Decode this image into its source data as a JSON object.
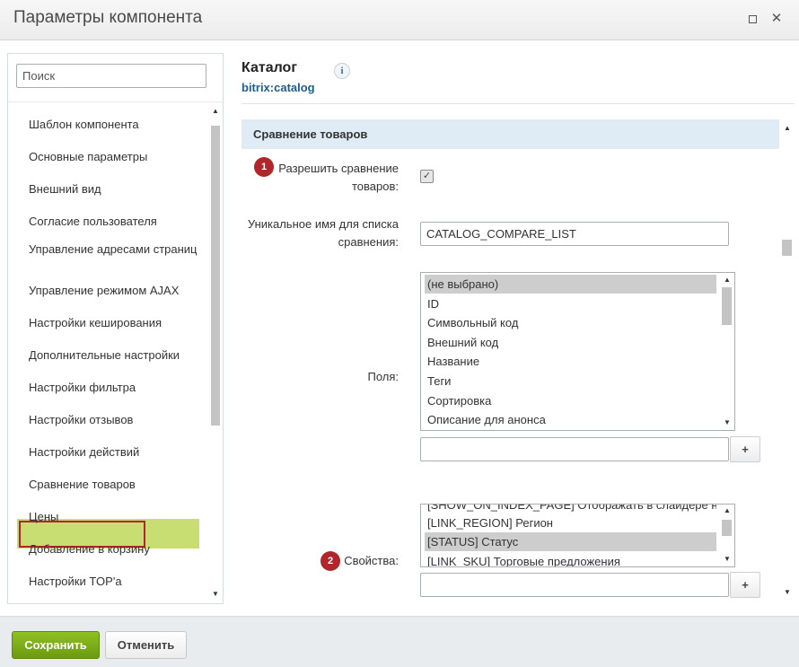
{
  "dialog": {
    "title": "Параметры компонента"
  },
  "sidebar": {
    "search_placeholder": "Поиск",
    "items": [
      {
        "label": "Шаблон компонента"
      },
      {
        "label": "Основные параметры"
      },
      {
        "label": "Внешний вид"
      },
      {
        "label": "Согласие пользователя"
      },
      {
        "label": "Управление адресами страниц"
      },
      {
        "label": "Управление режимом AJAX"
      },
      {
        "label": "Настройки кеширования"
      },
      {
        "label": "Дополнительные настройки"
      },
      {
        "label": "Настройки фильтра"
      },
      {
        "label": "Настройки отзывов"
      },
      {
        "label": "Настройки действий"
      },
      {
        "label": "Сравнение товаров"
      },
      {
        "label": "Цены"
      },
      {
        "label": "Добавление в корзину"
      },
      {
        "label": "Настройки TOP'а"
      }
    ],
    "active_item": "Сравнение товаров"
  },
  "header": {
    "title": "Каталог",
    "subtitle": "bitrix:catalog",
    "info_icon": "i"
  },
  "section": {
    "title": "Сравнение товаров",
    "allow_compare": {
      "badge": "1",
      "label": "Разрешить сравнение товаров:",
      "checked": true
    },
    "unique_name": {
      "label": "Уникальное имя для списка сравнения:",
      "value": "CATALOG_COMPARE_LIST"
    },
    "fields": {
      "label": "Поля:",
      "options": [
        "(не выбрано)",
        "ID",
        "Символьный код",
        "Внешний код",
        "Название",
        "Теги",
        "Сортировка",
        "Описание для анонса"
      ],
      "selected": "(не выбрано)",
      "extra_value": "",
      "add_label": "+"
    },
    "properties": {
      "badge": "2",
      "label": "Свойства:",
      "options": [
        "[SHOW_ON_INDEX_PAGE] Отображать в слайдере н",
        "[LINK_REGION] Регион",
        "[STATUS] Статус",
        "[LINK_SKU] Торговые предложения"
      ],
      "selected": "[STATUS] Статус",
      "extra_value": "",
      "add_label": "+"
    }
  },
  "footer": {
    "save_label": "Сохранить",
    "cancel_label": "Отменить"
  },
  "colors": {
    "active_item_bg": "#c8dd72",
    "active_item_frame": "#b0262a",
    "badge": "#b0262a",
    "section_head_bg": "#dfecf5",
    "save_button": "#7aab18",
    "link": "#1f5d8a"
  }
}
